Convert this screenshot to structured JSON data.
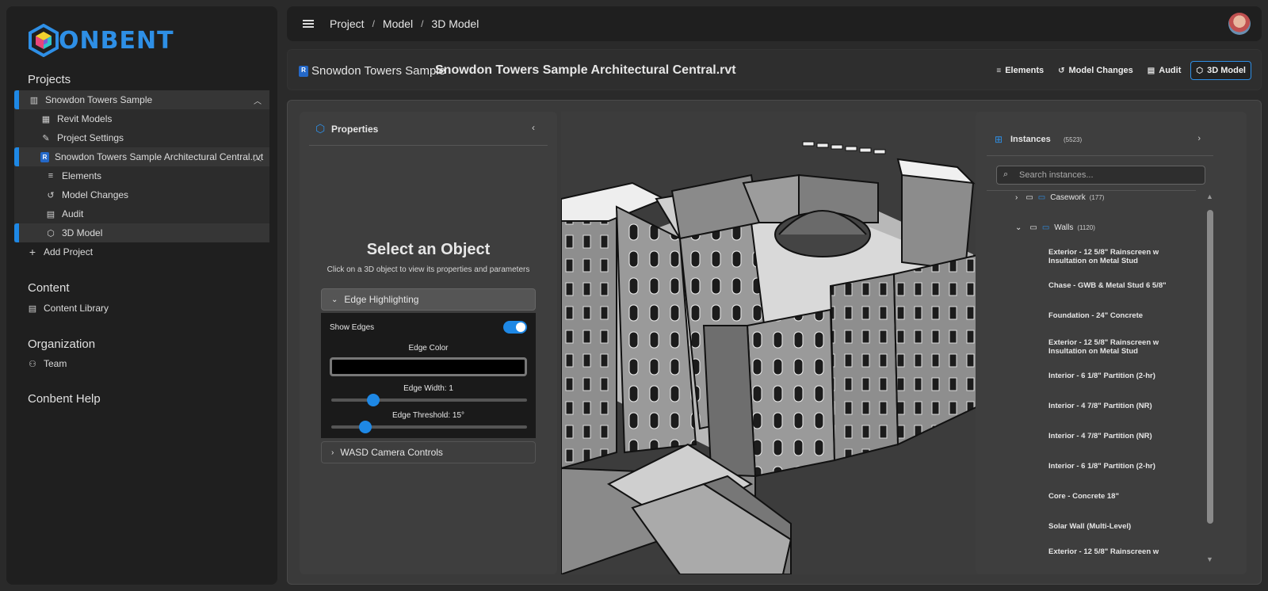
{
  "brand": {
    "logo_text": "ONBENT",
    "accent": "#1e88e5"
  },
  "sidebar": {
    "sections": {
      "projects": "Projects",
      "content": "Content",
      "organization": "Organization",
      "help": "Conbent Help"
    },
    "project_name": "Snowdon Towers Sample",
    "items": {
      "revit_models": "Revit Models",
      "project_settings": "Project Settings",
      "file": "Snowdon Towers Sample Architectural Central.rvt",
      "elements": "Elements",
      "model_changes": "Model Changes",
      "audit": "Audit",
      "model_3d": "3D Model",
      "add_project": "Add Project",
      "content_library": "Content Library",
      "team": "Team"
    }
  },
  "topbar": {
    "breadcrumb": [
      "Project",
      "Model",
      "3D Model"
    ],
    "separator": "/"
  },
  "header": {
    "project_name": "Snowdon Towers Sample",
    "file_name": "Snowdon Towers Sample Architectural Central.rvt",
    "buttons": {
      "elements": "Elements",
      "model_changes": "Model Changes",
      "audit": "Audit",
      "model_3d": "3D Model"
    },
    "selected": "3D Model"
  },
  "properties": {
    "title": "Properties",
    "select_title": "Select an Object",
    "select_subtitle": "Click on a 3D object to view its properties and parameters",
    "edge_section": "Edge Highlighting",
    "show_edges_label": "Show Edges",
    "show_edges": true,
    "edge_color_label": "Edge Color",
    "edge_color": "#000000",
    "edge_width_label": "Edge Width: 1",
    "edge_width": 1,
    "edge_threshold_label": "Edge Threshold: 15°",
    "edge_threshold": 15,
    "camera_section": "WASD Camera Controls"
  },
  "instances": {
    "title": "Instances",
    "count": "(5523)",
    "search_placeholder": "Search instances...",
    "folders": [
      {
        "label": "Casework",
        "count": "(177)",
        "expanded": false
      },
      {
        "label": "Walls",
        "count": "(1120)",
        "expanded": true
      }
    ],
    "walls": [
      "Exterior - 12 5/8\" Rainscreen w Insultation on Metal Stud",
      "Chase - GWB & Metal Stud 6 5/8\"",
      "Foundation - 24\" Concrete",
      "Exterior - 12 5/8\" Rainscreen w Insultation on Metal Stud",
      "Interior - 6 1/8\" Partition (2-hr)",
      "Interior - 4 7/8\" Partition (NR)",
      "Interior - 4 7/8\" Partition (NR)",
      "Interior - 6 1/8\" Partition (2-hr)",
      "Core - Concrete 18\"",
      "Solar Wall (Multi-Level)",
      "Exterior - 12 5/8\" Rainscreen w"
    ]
  }
}
